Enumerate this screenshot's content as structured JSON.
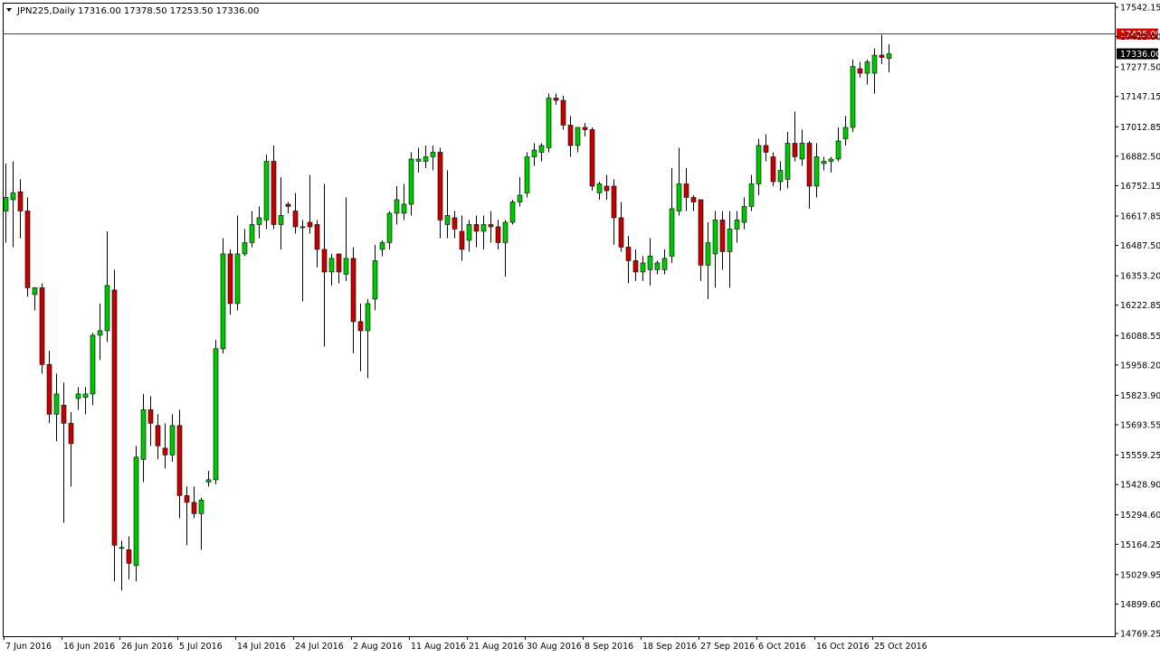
{
  "header": {
    "symbol_timeframe": "JPN225,Daily",
    "ohlc": "17316.00 17378.50 17253.50 17336.00",
    "menu_icon": "triangle-down-icon"
  },
  "colors": {
    "background": "#ffffff",
    "frame": "#000000",
    "bull_fill": "#00c800",
    "bear_fill": "#c80000",
    "wick": "#000000",
    "price_line": "#e00000",
    "current_price_bg": "#000000",
    "current_price_text": "#ffffff",
    "level_label_bg": "#e00000",
    "level_label_text": "#ffffff",
    "axis_text": "#000000"
  },
  "chart_data": {
    "type": "candlestick",
    "title": "JPN225,Daily",
    "grid": false,
    "ylim": [
      14769.25,
      17542.15
    ],
    "y_ticks": [
      "17542.15",
      "17412.00",
      "17277.50",
      "17147.15",
      "17012.85",
      "16882.50",
      "16752.15",
      "16617.85",
      "16487.50",
      "16353.20",
      "16222.85",
      "16088.55",
      "15958.20",
      "15823.90",
      "15693.55",
      "15559.25",
      "15428.90",
      "15294.60",
      "15164.25",
      "15029.95",
      "14899.60",
      "14769.25"
    ],
    "x_ticks": [
      {
        "index": 0,
        "label": "7 Jun 2016"
      },
      {
        "index": 8,
        "label": "16 Jun 2016"
      },
      {
        "index": 16,
        "label": "26 Jun 2016"
      },
      {
        "index": 24,
        "label": "5 Jul 2016"
      },
      {
        "index": 32,
        "label": "14 Jul 2016"
      },
      {
        "index": 40,
        "label": "24 Jul 2016"
      },
      {
        "index": 48,
        "label": "2 Aug 2016"
      },
      {
        "index": 56,
        "label": "11 Aug 2016"
      },
      {
        "index": 64,
        "label": "21 Aug 2016"
      },
      {
        "index": 72,
        "label": "30 Aug 2016"
      },
      {
        "index": 80,
        "label": "8 Sep 2016"
      },
      {
        "index": 88,
        "label": "18 Sep 2016"
      },
      {
        "index": 96,
        "label": "27 Sep 2016"
      },
      {
        "index": 104,
        "label": "6 Oct 2016"
      },
      {
        "index": 112,
        "label": "16 Oct 2016"
      },
      {
        "index": 120,
        "label": "25 Oct 2016"
      }
    ],
    "horizontal_levels": [
      {
        "value": 17425.0,
        "label": "17425.00",
        "color": "#e00000"
      }
    ],
    "current_price": {
      "value": 17336.0,
      "label": "17336.00"
    },
    "candles": [
      {
        "o": 16640,
        "h": 16850,
        "l": 16500,
        "c": 16700
      },
      {
        "o": 16690,
        "h": 16860,
        "l": 16480,
        "c": 16720
      },
      {
        "o": 16725,
        "h": 16780,
        "l": 16520,
        "c": 16640
      },
      {
        "o": 16640,
        "h": 16700,
        "l": 16260,
        "c": 16300
      },
      {
        "o": 16270,
        "h": 16300,
        "l": 16200,
        "c": 16300
      },
      {
        "o": 16300,
        "h": 16320,
        "l": 15920,
        "c": 15960
      },
      {
        "o": 15960,
        "h": 16020,
        "l": 15700,
        "c": 15740
      },
      {
        "o": 15740,
        "h": 15920,
        "l": 15620,
        "c": 15830
      },
      {
        "o": 15780,
        "h": 15880,
        "l": 15260,
        "c": 15700
      },
      {
        "o": 15700,
        "h": 15750,
        "l": 15420,
        "c": 15610
      },
      {
        "o": 15810,
        "h": 15860,
        "l": 15760,
        "c": 15830
      },
      {
        "o": 15815,
        "h": 15860,
        "l": 15740,
        "c": 15830
      },
      {
        "o": 15830,
        "h": 16100,
        "l": 15780,
        "c": 16090
      },
      {
        "o": 16090,
        "h": 16230,
        "l": 15980,
        "c": 16110
      },
      {
        "o": 16110,
        "h": 16550,
        "l": 16060,
        "c": 16310
      },
      {
        "o": 16290,
        "h": 16380,
        "l": 15000,
        "c": 15160
      },
      {
        "o": 15150,
        "h": 15180,
        "l": 14960,
        "c": 15150
      },
      {
        "o": 15140,
        "h": 15200,
        "l": 15010,
        "c": 15080
      },
      {
        "o": 15070,
        "h": 15600,
        "l": 15000,
        "c": 15550
      },
      {
        "o": 15540,
        "h": 15830,
        "l": 15440,
        "c": 15760
      },
      {
        "o": 15760,
        "h": 15820,
        "l": 15600,
        "c": 15700
      },
      {
        "o": 15690,
        "h": 15740,
        "l": 15540,
        "c": 15600
      },
      {
        "o": 15590,
        "h": 15700,
        "l": 15500,
        "c": 15560
      },
      {
        "o": 15560,
        "h": 15740,
        "l": 15530,
        "c": 15690
      },
      {
        "o": 15690,
        "h": 15760,
        "l": 15280,
        "c": 15380
      },
      {
        "o": 15380,
        "h": 15420,
        "l": 15160,
        "c": 15350
      },
      {
        "o": 15350,
        "h": 15420,
        "l": 15280,
        "c": 15300
      },
      {
        "o": 15300,
        "h": 15370,
        "l": 15140,
        "c": 15360
      },
      {
        "o": 15440,
        "h": 15490,
        "l": 15420,
        "c": 15450
      },
      {
        "o": 15450,
        "h": 16070,
        "l": 15430,
        "c": 16030
      },
      {
        "o": 16030,
        "h": 16520,
        "l": 16010,
        "c": 16450
      },
      {
        "o": 16450,
        "h": 16470,
        "l": 16180,
        "c": 16230
      },
      {
        "o": 16230,
        "h": 16620,
        "l": 16200,
        "c": 16450
      },
      {
        "o": 16450,
        "h": 16560,
        "l": 16440,
        "c": 16500
      },
      {
        "o": 16500,
        "h": 16640,
        "l": 16480,
        "c": 16580
      },
      {
        "o": 16580,
        "h": 16660,
        "l": 16520,
        "c": 16610
      },
      {
        "o": 16600,
        "h": 16890,
        "l": 16560,
        "c": 16860
      },
      {
        "o": 16860,
        "h": 16930,
        "l": 16560,
        "c": 16580
      },
      {
        "o": 16580,
        "h": 16790,
        "l": 16470,
        "c": 16620
      },
      {
        "o": 16670,
        "h": 16680,
        "l": 16630,
        "c": 16660
      },
      {
        "o": 16640,
        "h": 16720,
        "l": 16540,
        "c": 16570
      },
      {
        "o": 16570,
        "h": 16600,
        "l": 16240,
        "c": 16570
      },
      {
        "o": 16590,
        "h": 16800,
        "l": 16540,
        "c": 16570
      },
      {
        "o": 16580,
        "h": 16600,
        "l": 16390,
        "c": 16470
      },
      {
        "o": 16470,
        "h": 16760,
        "l": 16040,
        "c": 16370
      },
      {
        "o": 16370,
        "h": 16450,
        "l": 16310,
        "c": 16430
      },
      {
        "o": 16450,
        "h": 16450,
        "l": 16320,
        "c": 16370
      },
      {
        "o": 16360,
        "h": 16700,
        "l": 16330,
        "c": 16430
      },
      {
        "o": 16430,
        "h": 16480,
        "l": 16010,
        "c": 16150
      },
      {
        "o": 16150,
        "h": 16230,
        "l": 15930,
        "c": 16110
      },
      {
        "o": 16110,
        "h": 16250,
        "l": 15900,
        "c": 16230
      },
      {
        "o": 16250,
        "h": 16490,
        "l": 16200,
        "c": 16420
      },
      {
        "o": 16470,
        "h": 16510,
        "l": 16440,
        "c": 16500
      },
      {
        "o": 16500,
        "h": 16640,
        "l": 16470,
        "c": 16630
      },
      {
        "o": 16630,
        "h": 16750,
        "l": 16580,
        "c": 16690
      },
      {
        "o": 16630,
        "h": 16760,
        "l": 16600,
        "c": 16670
      },
      {
        "o": 16670,
        "h": 16900,
        "l": 16620,
        "c": 16870
      },
      {
        "o": 16860,
        "h": 16920,
        "l": 16810,
        "c": 16870
      },
      {
        "o": 16860,
        "h": 16930,
        "l": 16830,
        "c": 16880
      },
      {
        "o": 16880,
        "h": 16930,
        "l": 16820,
        "c": 16900
      },
      {
        "o": 16900,
        "h": 16920,
        "l": 16520,
        "c": 16600
      },
      {
        "o": 16580,
        "h": 16820,
        "l": 16520,
        "c": 16620
      },
      {
        "o": 16610,
        "h": 16640,
        "l": 16520,
        "c": 16560
      },
      {
        "o": 16550,
        "h": 16620,
        "l": 16420,
        "c": 16470
      },
      {
        "o": 16510,
        "h": 16600,
        "l": 16460,
        "c": 16580
      },
      {
        "o": 16580,
        "h": 16620,
        "l": 16480,
        "c": 16550
      },
      {
        "o": 16550,
        "h": 16620,
        "l": 16470,
        "c": 16580
      },
      {
        "o": 16580,
        "h": 16640,
        "l": 16500,
        "c": 16570
      },
      {
        "o": 16570,
        "h": 16600,
        "l": 16470,
        "c": 16500
      },
      {
        "o": 16500,
        "h": 16600,
        "l": 16350,
        "c": 16590
      },
      {
        "o": 16590,
        "h": 16690,
        "l": 16580,
        "c": 16680
      },
      {
        "o": 16680,
        "h": 16790,
        "l": 16660,
        "c": 16710
      },
      {
        "o": 16720,
        "h": 16900,
        "l": 16700,
        "c": 16880
      },
      {
        "o": 16880,
        "h": 16940,
        "l": 16840,
        "c": 16910
      },
      {
        "o": 16900,
        "h": 16940,
        "l": 16860,
        "c": 16930
      },
      {
        "o": 16920,
        "h": 17160,
        "l": 16900,
        "c": 17140
      },
      {
        "o": 17140,
        "h": 17160,
        "l": 17110,
        "c": 17130
      },
      {
        "o": 17130,
        "h": 17150,
        "l": 17000,
        "c": 17020
      },
      {
        "o": 17020,
        "h": 17060,
        "l": 16880,
        "c": 16930
      },
      {
        "o": 16930,
        "h": 17010,
        "l": 16900,
        "c": 17010
      },
      {
        "o": 17010,
        "h": 17030,
        "l": 16970,
        "c": 17000
      },
      {
        "o": 17000,
        "h": 17010,
        "l": 16730,
        "c": 16750
      },
      {
        "o": 16720,
        "h": 16770,
        "l": 16690,
        "c": 16760
      },
      {
        "o": 16750,
        "h": 16800,
        "l": 16690,
        "c": 16730
      },
      {
        "o": 16750,
        "h": 16780,
        "l": 16490,
        "c": 16610
      },
      {
        "o": 16610,
        "h": 16680,
        "l": 16460,
        "c": 16480
      },
      {
        "o": 16480,
        "h": 16530,
        "l": 16320,
        "c": 16420
      },
      {
        "o": 16420,
        "h": 16470,
        "l": 16330,
        "c": 16370
      },
      {
        "o": 16370,
        "h": 16440,
        "l": 16330,
        "c": 16410
      },
      {
        "o": 16380,
        "h": 16520,
        "l": 16310,
        "c": 16440
      },
      {
        "o": 16380,
        "h": 16420,
        "l": 16360,
        "c": 16410
      },
      {
        "o": 16380,
        "h": 16470,
        "l": 16360,
        "c": 16430
      },
      {
        "o": 16440,
        "h": 16830,
        "l": 16410,
        "c": 16650
      },
      {
        "o": 16640,
        "h": 16920,
        "l": 16620,
        "c": 16760
      },
      {
        "o": 16760,
        "h": 16830,
        "l": 16640,
        "c": 16700
      },
      {
        "o": 16700,
        "h": 16710,
        "l": 16640,
        "c": 16680
      },
      {
        "o": 16690,
        "h": 16690,
        "l": 16330,
        "c": 16400
      },
      {
        "o": 16400,
        "h": 16590,
        "l": 16250,
        "c": 16500
      },
      {
        "o": 16450,
        "h": 16640,
        "l": 16300,
        "c": 16600
      },
      {
        "o": 16600,
        "h": 16640,
        "l": 16380,
        "c": 16460
      },
      {
        "o": 16460,
        "h": 16640,
        "l": 16300,
        "c": 16560
      },
      {
        "o": 16560,
        "h": 16640,
        "l": 16500,
        "c": 16600
      },
      {
        "o": 16590,
        "h": 16700,
        "l": 16560,
        "c": 16660
      },
      {
        "o": 16660,
        "h": 16800,
        "l": 16640,
        "c": 16760
      },
      {
        "o": 16760,
        "h": 16960,
        "l": 16710,
        "c": 16930
      },
      {
        "o": 16930,
        "h": 16980,
        "l": 16860,
        "c": 16900
      },
      {
        "o": 16880,
        "h": 16900,
        "l": 16750,
        "c": 16770
      },
      {
        "o": 16770,
        "h": 16860,
        "l": 16730,
        "c": 16820
      },
      {
        "o": 16780,
        "h": 16990,
        "l": 16740,
        "c": 16940
      },
      {
        "o": 16940,
        "h": 17080,
        "l": 16860,
        "c": 16880
      },
      {
        "o": 16870,
        "h": 17000,
        "l": 16840,
        "c": 16940
      },
      {
        "o": 16940,
        "h": 16950,
        "l": 16650,
        "c": 16750
      },
      {
        "o": 16750,
        "h": 16940,
        "l": 16700,
        "c": 16880
      },
      {
        "o": 16850,
        "h": 16880,
        "l": 16820,
        "c": 16860
      },
      {
        "o": 16860,
        "h": 16880,
        "l": 16810,
        "c": 16870
      },
      {
        "o": 16870,
        "h": 17010,
        "l": 16860,
        "c": 16950
      },
      {
        "o": 16960,
        "h": 17060,
        "l": 16930,
        "c": 17010
      },
      {
        "o": 17010,
        "h": 17310,
        "l": 16990,
        "c": 17280
      },
      {
        "o": 17270,
        "h": 17300,
        "l": 17230,
        "c": 17250
      },
      {
        "o": 17250,
        "h": 17310,
        "l": 17200,
        "c": 17300
      },
      {
        "o": 17250,
        "h": 17360,
        "l": 17160,
        "c": 17330
      },
      {
        "o": 17330,
        "h": 17420,
        "l": 17290,
        "c": 17320
      },
      {
        "o": 17316,
        "h": 17378.5,
        "l": 17253.5,
        "c": 17336
      }
    ]
  }
}
